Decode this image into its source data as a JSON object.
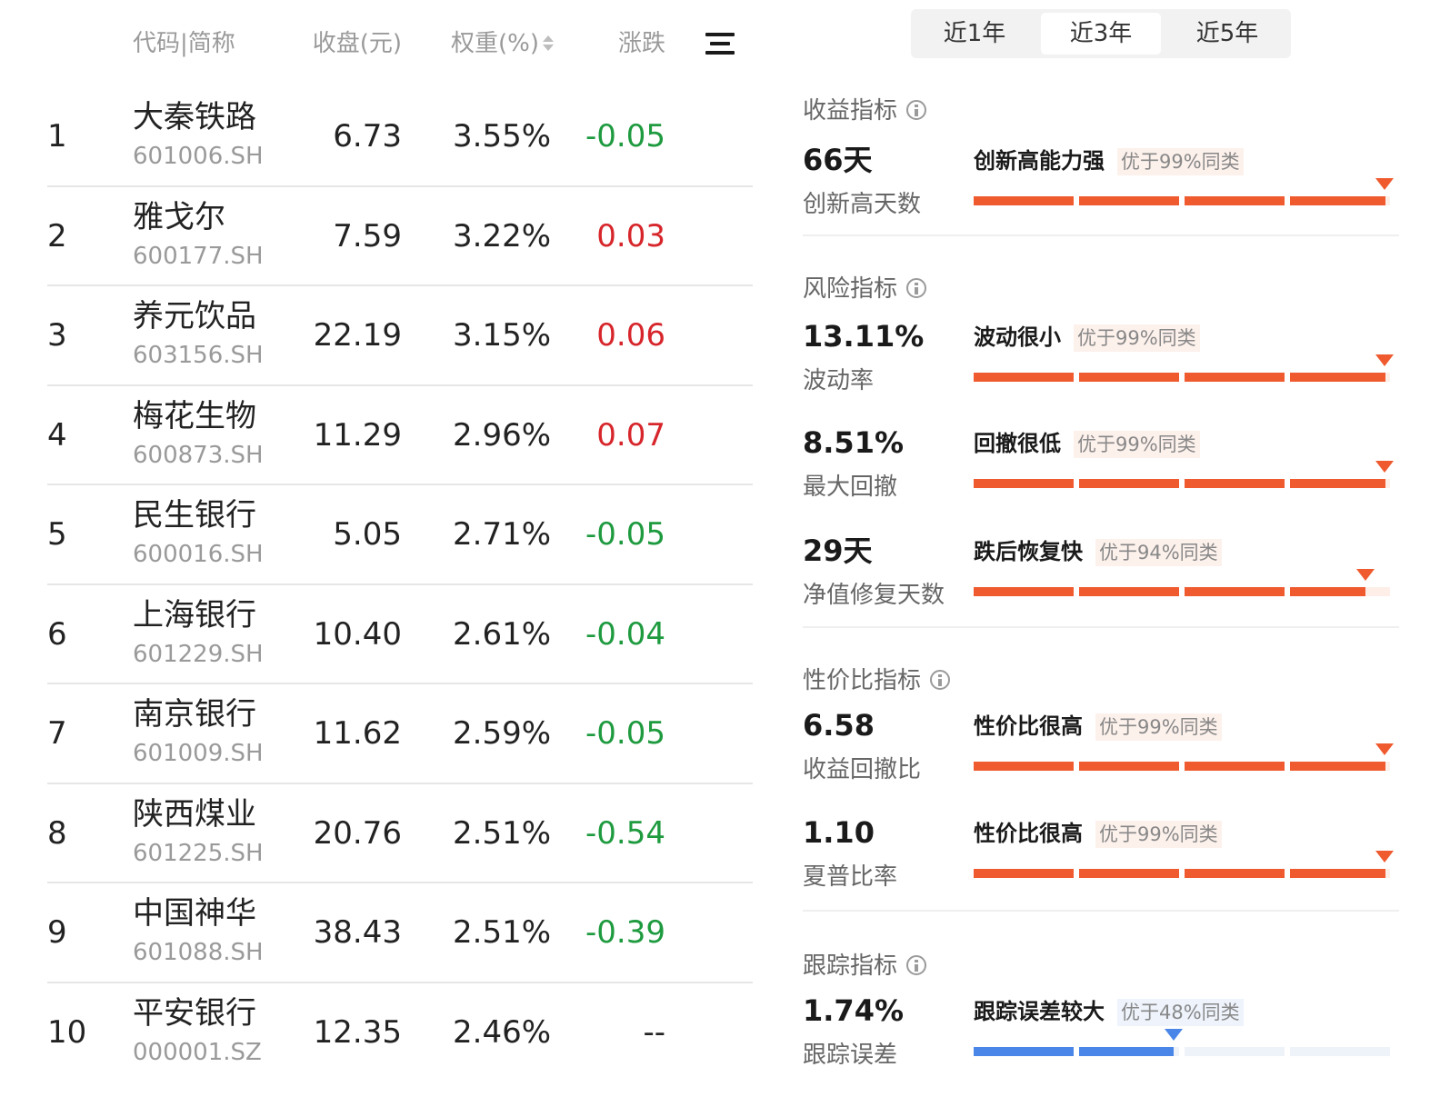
{
  "table": {
    "headers": {
      "name": "代码|简称",
      "close": "收盘(元)",
      "weight": "权重(%)",
      "change": "涨跌"
    },
    "rows": [
      {
        "rank": "1",
        "name": "大秦铁路",
        "code": "601006.SH",
        "close": "6.73",
        "weight": "3.55%",
        "change": "-0.05",
        "dir": "down"
      },
      {
        "rank": "2",
        "name": "雅戈尔",
        "code": "600177.SH",
        "close": "7.59",
        "weight": "3.22%",
        "change": "0.03",
        "dir": "up"
      },
      {
        "rank": "3",
        "name": "养元饮品",
        "code": "603156.SH",
        "close": "22.19",
        "weight": "3.15%",
        "change": "0.06",
        "dir": "up"
      },
      {
        "rank": "4",
        "name": "梅花生物",
        "code": "600873.SH",
        "close": "11.29",
        "weight": "2.96%",
        "change": "0.07",
        "dir": "up"
      },
      {
        "rank": "5",
        "name": "民生银行",
        "code": "600016.SH",
        "close": "5.05",
        "weight": "2.71%",
        "change": "-0.05",
        "dir": "down"
      },
      {
        "rank": "6",
        "name": "上海银行",
        "code": "601229.SH",
        "close": "10.40",
        "weight": "2.61%",
        "change": "-0.04",
        "dir": "down"
      },
      {
        "rank": "7",
        "name": "南京银行",
        "code": "601009.SH",
        "close": "11.62",
        "weight": "2.59%",
        "change": "-0.05",
        "dir": "down"
      },
      {
        "rank": "8",
        "name": "陕西煤业",
        "code": "601225.SH",
        "close": "20.76",
        "weight": "2.51%",
        "change": "-0.54",
        "dir": "down"
      },
      {
        "rank": "9",
        "name": "中国神华",
        "code": "601088.SH",
        "close": "38.43",
        "weight": "2.51%",
        "change": "-0.39",
        "dir": "down"
      },
      {
        "rank": "10",
        "name": "平安银行",
        "code": "000001.SZ",
        "close": "12.35",
        "weight": "2.46%",
        "change": "--",
        "dir": "flat"
      }
    ]
  },
  "period_tabs": {
    "selected": "近3年",
    "labels": [
      "近1年",
      "近3年",
      "近5年"
    ]
  },
  "sections": {
    "return": {
      "title": "收益指标"
    },
    "risk": {
      "title": "风险指标"
    },
    "value": {
      "title": "性价比指标"
    },
    "tracking": {
      "title": "跟踪指标"
    }
  },
  "metrics": {
    "new_high_days": {
      "value": "66天",
      "label": "创新高天数",
      "tag": "创新高能力强",
      "rank": "优于99%同类",
      "percentile": 99,
      "color": "orange"
    },
    "volatility": {
      "value": "13.11%",
      "label": "波动率",
      "tag": "波动很小",
      "rank": "优于99%同类",
      "percentile": 99,
      "color": "orange"
    },
    "max_drawdown": {
      "value": "8.51%",
      "label": "最大回撤",
      "tag": "回撤很低",
      "rank": "优于99%同类",
      "percentile": 99,
      "color": "orange"
    },
    "recovery_days": {
      "value": "29天",
      "label": "净值修复天数",
      "tag": "跌后恢复快",
      "rank": "优于94%同类",
      "percentile": 94,
      "color": "orange"
    },
    "return_drawdown_ratio": {
      "value": "6.58",
      "label": "收益回撤比",
      "tag": "性价比很高",
      "rank": "优于99%同类",
      "percentile": 99,
      "color": "orange"
    },
    "sharpe": {
      "value": "1.10",
      "label": "夏普比率",
      "tag": "性价比很高",
      "rank": "优于99%同类",
      "percentile": 99,
      "color": "orange"
    },
    "tracking_error": {
      "value": "1.74%",
      "label": "跟踪误差",
      "tag": "跟踪误差较大",
      "rank": "优于48%同类",
      "percentile": 48,
      "color": "blue"
    }
  },
  "colors": {
    "up": "#d7262b",
    "down": "#1e9a3f",
    "bar_orange": "#ef5a2f",
    "bar_blue": "#4a86e8"
  }
}
